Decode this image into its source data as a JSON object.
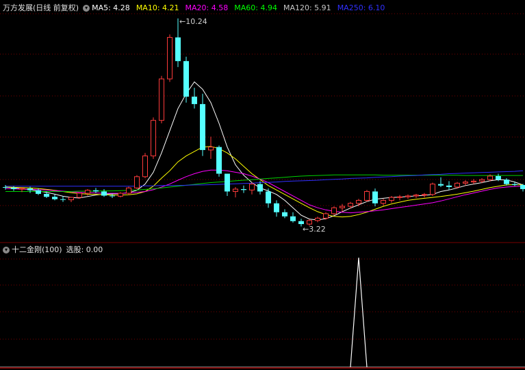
{
  "header": {
    "stock_title": "万方发展(日线 前复权)",
    "ma_items": [
      {
        "label": "MA5: 4.28",
        "color": "#ffffff"
      },
      {
        "label": "MA10: 4.21",
        "color": "#ffff00"
      },
      {
        "label": "MA20: 4.58",
        "color": "#ff00ff"
      },
      {
        "label": "MA60: 4.94",
        "color": "#00ff00"
      },
      {
        "label": "MA120: 5.91",
        "color": "#c8c8c8"
      },
      {
        "label": "MA250: 6.10",
        "color": "#3030ff"
      }
    ]
  },
  "annotations": {
    "high": "10.24",
    "low": "3.22"
  },
  "indicator": {
    "title": "十二金刚(100)",
    "value": "选股: 0.00"
  },
  "colors": {
    "up": "#ff3b3b",
    "down": "#55ffff",
    "grid": "#7a0000",
    "signal": "#ffffff"
  },
  "candles": [
    [
      4.55,
      4.62,
      4.46,
      4.53
    ],
    [
      4.53,
      4.58,
      4.42,
      4.48
    ],
    [
      4.48,
      4.55,
      4.38,
      4.5
    ],
    [
      4.5,
      4.56,
      4.35,
      4.44
    ],
    [
      4.44,
      4.5,
      4.28,
      4.32
    ],
    [
      4.32,
      4.4,
      4.18,
      4.22
    ],
    [
      4.22,
      4.3,
      4.1,
      4.14
    ],
    [
      4.14,
      4.24,
      4.05,
      4.12
    ],
    [
      4.12,
      4.22,
      4.04,
      4.2
    ],
    [
      4.2,
      4.36,
      4.16,
      4.34
    ],
    [
      4.34,
      4.48,
      4.26,
      4.44
    ],
    [
      4.44,
      4.52,
      4.34,
      4.4
    ],
    [
      4.4,
      4.48,
      4.22,
      4.26
    ],
    [
      4.26,
      4.32,
      4.18,
      4.24
    ],
    [
      4.24,
      4.38,
      4.2,
      4.34
    ],
    [
      4.34,
      4.56,
      4.28,
      4.52
    ],
    [
      4.52,
      4.95,
      4.48,
      4.9
    ],
    [
      4.9,
      5.7,
      4.85,
      5.6
    ],
    [
      5.6,
      6.9,
      5.5,
      6.8
    ],
    [
      6.8,
      8.3,
      6.7,
      8.2
    ],
    [
      8.2,
      9.7,
      8.1,
      9.6
    ],
    [
      9.6,
      10.24,
      8.6,
      8.8
    ],
    [
      8.8,
      8.95,
      7.4,
      7.6
    ],
    [
      7.6,
      7.9,
      7.2,
      7.35
    ],
    [
      7.35,
      7.7,
      5.6,
      5.8
    ],
    [
      5.8,
      6.25,
      5.5,
      5.9
    ],
    [
      5.9,
      5.95,
      4.9,
      5.0
    ],
    [
      5.0,
      4.95,
      4.25,
      4.4
    ],
    [
      4.4,
      4.55,
      4.2,
      4.48
    ],
    [
      4.48,
      4.6,
      4.35,
      4.45
    ],
    [
      4.45,
      4.7,
      4.3,
      4.65
    ],
    [
      4.65,
      4.75,
      4.3,
      4.4
    ],
    [
      4.4,
      4.5,
      3.85,
      4.0
    ],
    [
      4.0,
      4.1,
      3.55,
      3.7
    ],
    [
      3.7,
      3.8,
      3.5,
      3.56
    ],
    [
      3.56,
      3.7,
      3.35,
      3.4
    ],
    [
      3.4,
      3.48,
      3.22,
      3.3
    ],
    [
      3.3,
      3.46,
      3.25,
      3.42
    ],
    [
      3.42,
      3.55,
      3.36,
      3.5
    ],
    [
      3.5,
      3.7,
      3.45,
      3.65
    ],
    [
      3.65,
      3.9,
      3.6,
      3.85
    ],
    [
      3.85,
      3.98,
      3.72,
      3.9
    ],
    [
      3.9,
      4.05,
      3.82,
      4.0
    ],
    [
      4.0,
      4.15,
      3.9,
      4.1
    ],
    [
      4.1,
      4.45,
      4.05,
      4.4
    ],
    [
      4.4,
      4.5,
      3.9,
      4.0
    ],
    [
      4.0,
      4.15,
      3.92,
      4.1
    ],
    [
      4.1,
      4.25,
      4.02,
      4.2
    ],
    [
      4.2,
      4.28,
      4.1,
      4.22
    ],
    [
      4.22,
      4.3,
      4.15,
      4.25
    ],
    [
      4.25,
      4.32,
      4.18,
      4.28
    ],
    [
      4.28,
      4.35,
      4.2,
      4.3
    ],
    [
      4.3,
      4.7,
      4.25,
      4.65
    ],
    [
      4.65,
      4.88,
      4.55,
      4.6
    ],
    [
      4.6,
      4.75,
      4.45,
      4.55
    ],
    [
      4.55,
      4.72,
      4.5,
      4.68
    ],
    [
      4.68,
      4.78,
      4.6,
      4.72
    ],
    [
      4.72,
      4.82,
      4.65,
      4.75
    ],
    [
      4.75,
      4.85,
      4.68,
      4.8
    ],
    [
      4.8,
      4.98,
      4.75,
      4.92
    ],
    [
      4.92,
      5.0,
      4.75,
      4.8
    ],
    [
      4.8,
      4.85,
      4.6,
      4.65
    ],
    [
      4.65,
      4.72,
      4.58,
      4.62
    ],
    [
      4.62,
      4.66,
      4.4,
      4.48
    ]
  ],
  "ma_series": {
    "ma5": [
      4.55,
      4.52,
      4.49,
      4.46,
      4.42,
      4.37,
      4.31,
      4.24,
      4.2,
      4.18,
      4.23,
      4.28,
      4.31,
      4.32,
      4.33,
      4.36,
      4.44,
      4.65,
      5.05,
      5.7,
      6.45,
      7.2,
      7.7,
      8.1,
      7.85,
      7.4,
      6.7,
      5.9,
      5.3,
      4.95,
      4.7,
      4.52,
      4.42,
      4.3,
      4.1,
      3.85,
      3.6,
      3.47,
      3.44,
      3.48,
      3.58,
      3.72,
      3.84,
      3.95,
      4.06,
      4.14,
      4.17,
      4.2,
      4.21,
      4.23,
      4.25,
      4.27,
      4.3,
      4.4,
      4.45,
      4.52,
      4.6,
      4.65,
      4.7,
      4.76,
      4.8,
      4.79,
      4.72,
      4.62
    ],
    "ma10": [
      4.55,
      4.54,
      4.53,
      4.52,
      4.5,
      4.47,
      4.44,
      4.4,
      4.36,
      4.33,
      4.31,
      4.3,
      4.29,
      4.28,
      4.28,
      4.29,
      4.32,
      4.4,
      4.58,
      4.85,
      5.1,
      5.4,
      5.6,
      5.75,
      5.9,
      5.92,
      5.85,
      5.7,
      5.5,
      5.25,
      5.0,
      4.8,
      4.6,
      4.45,
      4.3,
      4.15,
      4.0,
      3.85,
      3.72,
      3.62,
      3.56,
      3.54,
      3.56,
      3.62,
      3.7,
      3.8,
      3.9,
      3.98,
      4.04,
      4.1,
      4.14,
      4.17,
      4.2,
      4.23,
      4.27,
      4.31,
      4.36,
      4.41,
      4.47,
      4.53,
      4.58,
      4.62,
      4.63,
      4.62
    ],
    "ma20": [
      4.5,
      4.49,
      4.48,
      4.47,
      4.46,
      4.45,
      4.43,
      4.41,
      4.39,
      4.37,
      4.36,
      4.35,
      4.34,
      4.34,
      4.34,
      4.35,
      4.37,
      4.4,
      4.46,
      4.55,
      4.65,
      4.78,
      4.9,
      5.0,
      5.08,
      5.12,
      5.12,
      5.1,
      5.05,
      5.0,
      4.92,
      4.82,
      4.7,
      4.55,
      4.4,
      4.25,
      4.1,
      3.95,
      3.85,
      3.78,
      3.73,
      3.7,
      3.68,
      3.7,
      3.72,
      3.75,
      3.78,
      3.82,
      3.86,
      3.9,
      3.94,
      3.98,
      4.02,
      4.08,
      4.15,
      4.22,
      4.29,
      4.35,
      4.41,
      4.47,
      4.52,
      4.55,
      4.57,
      4.58
    ],
    "ma60": [
      4.4,
      4.4,
      4.4,
      4.4,
      4.4,
      4.4,
      4.4,
      4.4,
      4.4,
      4.41,
      4.41,
      4.41,
      4.42,
      4.42,
      4.43,
      4.44,
      4.45,
      4.47,
      4.49,
      4.52,
      4.55,
      4.58,
      4.61,
      4.64,
      4.67,
      4.7,
      4.72,
      4.74,
      4.76,
      4.78,
      4.8,
      4.82,
      4.84,
      4.86,
      4.88,
      4.9,
      4.92,
      4.93,
      4.94,
      4.95,
      4.96,
      4.96,
      4.96,
      4.96,
      4.96,
      4.96,
      4.95,
      4.95,
      4.95,
      4.95,
      4.95,
      4.95,
      4.95,
      4.95,
      4.95,
      4.95,
      4.94,
      4.94,
      4.94,
      4.94,
      4.94,
      4.94,
      4.94,
      4.94
    ],
    "ma250": [
      4.58,
      4.58,
      4.58,
      4.58,
      4.58,
      4.58,
      4.58,
      4.58,
      4.58,
      4.58,
      4.58,
      4.58,
      4.58,
      4.58,
      4.58,
      4.58,
      4.58,
      4.59,
      4.59,
      4.6,
      4.6,
      4.6,
      4.61,
      4.62,
      4.62,
      4.63,
      4.64,
      4.65,
      4.66,
      4.67,
      4.68,
      4.7,
      4.71,
      4.72,
      4.74,
      4.75,
      4.76,
      4.77,
      4.78,
      4.8,
      4.81,
      4.82,
      4.84,
      4.85,
      4.86,
      4.88,
      4.89,
      4.9,
      4.92,
      4.93,
      4.94,
      4.96,
      4.97,
      4.98,
      5.0,
      5.01,
      5.02,
      5.03,
      5.04,
      5.05,
      5.06,
      5.07,
      5.08,
      5.1
    ]
  },
  "signal": {
    "index": 43,
    "value": 100
  }
}
